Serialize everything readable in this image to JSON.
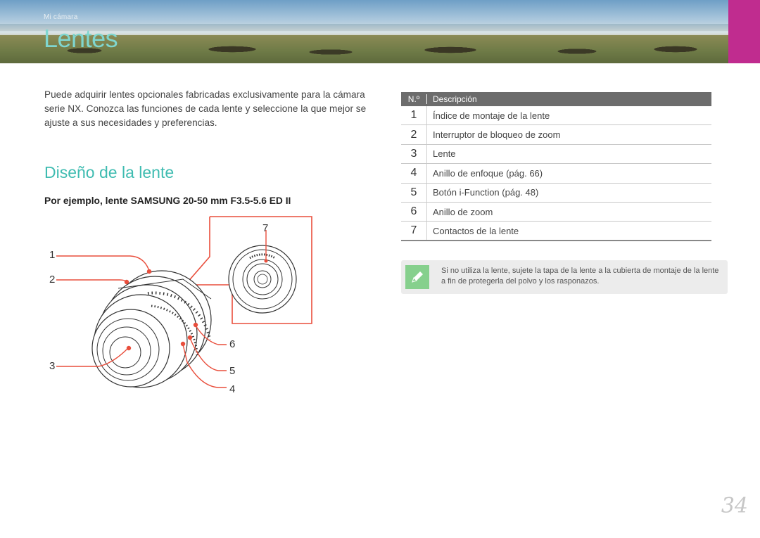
{
  "header": {
    "breadcrumb": "Mi cámara",
    "title": "Lentes",
    "accent_color": "#c02c8f",
    "title_color": "#7fd6cf"
  },
  "intro": "Puede adquirir lentes opcionales fabricadas exclusivamente para la cámara serie NX. Conozca las funciones de cada lente y seleccione la que mejor se ajuste a sus necesidades y preferencias.",
  "section": {
    "title": "Diseño de la lente",
    "example_caption": "Por ejemplo, lente SAMSUNG 20-50 mm F3.5-5.6 ED II"
  },
  "figure": {
    "callouts": [
      "1",
      "2",
      "3",
      "4",
      "5",
      "6",
      "7"
    ],
    "highlight_color": "#e94e3c"
  },
  "table": {
    "headers": [
      "N.º",
      "Descripción"
    ],
    "rows": [
      {
        "num": "1",
        "desc": "Índice de montaje de la lente"
      },
      {
        "num": "2",
        "desc": "Interruptor de bloqueo de zoom"
      },
      {
        "num": "3",
        "desc": "Lente"
      },
      {
        "num": "4",
        "desc": "Anillo de enfoque (pág. 66)"
      },
      {
        "num": "5",
        "desc": "Botón i-Function (pág. 48)"
      },
      {
        "num": "6",
        "desc": "Anillo de zoom"
      },
      {
        "num": "7",
        "desc": "Contactos de la lente"
      }
    ]
  },
  "note": {
    "icon": "pencil-note-icon",
    "text": "Si no utiliza la lente, sujete la tapa de la lente a la cubierta de montaje de la lente a fin de protegerla del polvo y los rasponazos."
  },
  "page_number": "34"
}
